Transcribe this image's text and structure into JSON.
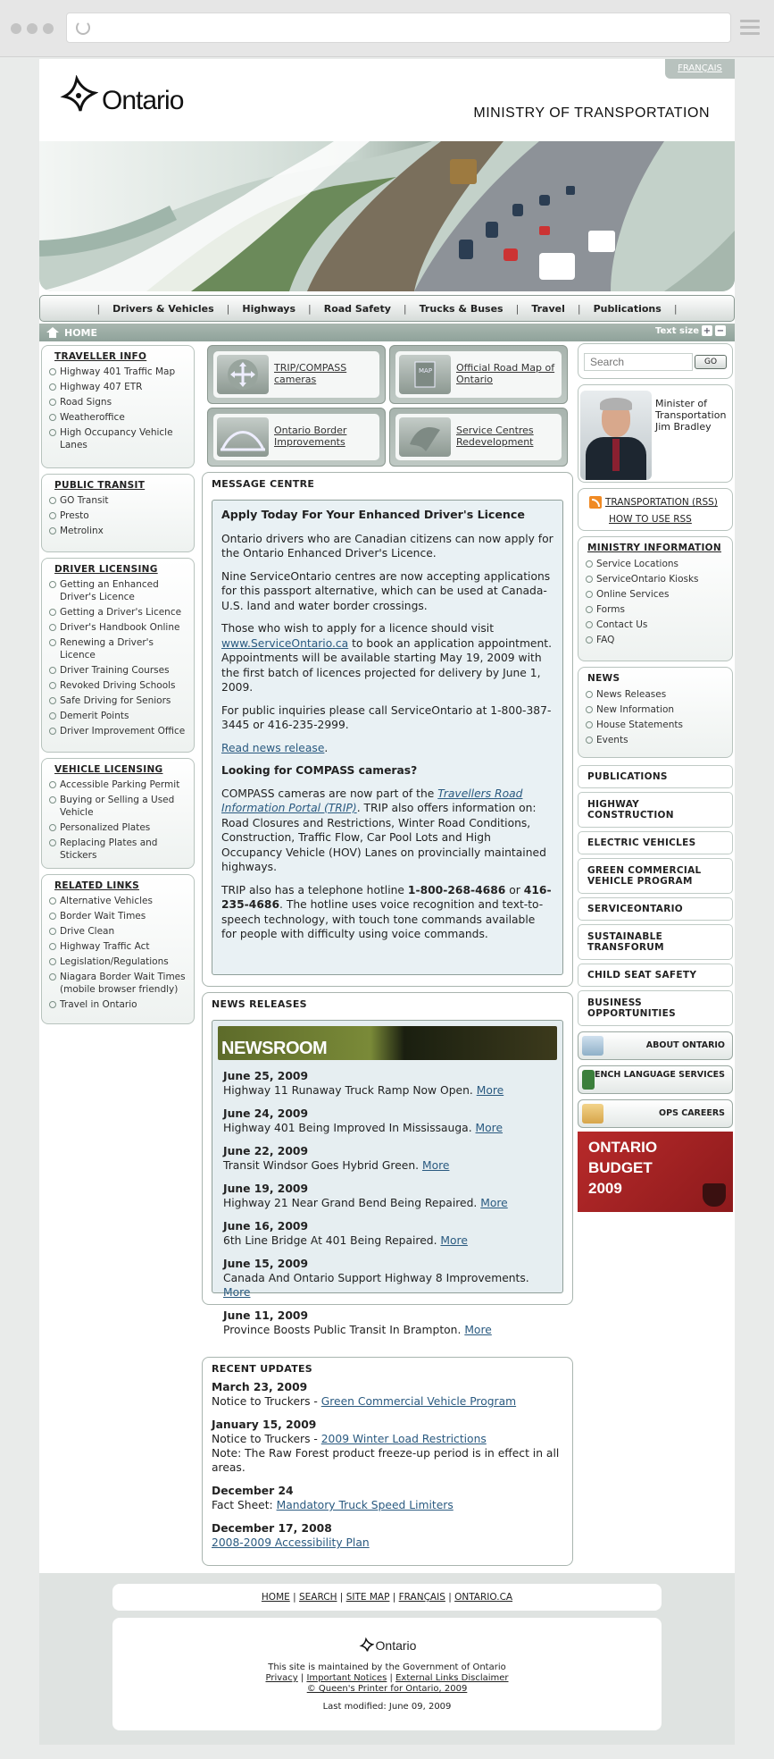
{
  "header": {
    "francais": "FRANÇAIS",
    "logo_text": "Ontario",
    "ministry": "MINISTRY OF TRANSPORTATION"
  },
  "nav": {
    "items": [
      "Drivers & Vehicles",
      "Highways",
      "Road Safety",
      "Trucks & Buses",
      "Travel",
      "Publications"
    ]
  },
  "homebar": {
    "home": "HOME",
    "text_size": "Text size",
    "plus": "+",
    "minus": "−"
  },
  "left": {
    "traveller": {
      "title": "TRAVELLER INFO",
      "items": [
        "Highway 401 Traffic Map",
        "Highway 407 ETR",
        "Road Signs",
        "Weatheroffice",
        "High Occupancy Vehicle Lanes"
      ]
    },
    "transit": {
      "title": "PUBLIC TRANSIT",
      "items": [
        "GO Transit",
        "Presto",
        "Metrolinx"
      ]
    },
    "driver": {
      "title": "DRIVER LICENSING",
      "items": [
        "Getting an Enhanced Driver's Licence",
        "Getting a Driver's Licence",
        "Driver's Handbook Online",
        "Renewing a Driver's Licence",
        "Driver Training Courses",
        "Revoked Driving Schools",
        "Safe Driving for Seniors",
        "Demerit Points",
        "Driver Improvement Office"
      ]
    },
    "vehicle": {
      "title": "VEHICLE LICENSING",
      "items": [
        "Accessible Parking Permit",
        "Buying or Selling a Used Vehicle",
        "Personalized Plates",
        "Replacing Plates and Stickers"
      ]
    },
    "related": {
      "title": "RELATED LINKS",
      "items": [
        "Alternative Vehicles",
        "Border Wait Times",
        "Drive Clean",
        "Highway Traffic Act",
        "Legislation/Regulations",
        "Niagara Border Wait Times (mobile browser friendly)",
        "Travel in Ontario"
      ]
    }
  },
  "tiles": [
    {
      "label": "TRIP/COMPASS cameras"
    },
    {
      "label": "Official Road Map of Ontario",
      "icon_text": "MAP"
    },
    {
      "label": "Ontario Border Improvements"
    },
    {
      "label": "Service Centres Redevelopment"
    }
  ],
  "message": {
    "title": "MESSAGE CENTRE",
    "heading": "Apply Today For Your Enhanced Driver's Licence",
    "p1": "Ontario drivers who are Canadian citizens can now apply for the Ontario Enhanced Driver's Licence.",
    "p2": "Nine ServiceOntario centres are now accepting applications for this passport alternative, which can be used at Canada-U.S. land and water border crossings.",
    "p3a": "Those who wish to apply for a licence should visit",
    "p3link": "www.ServiceOntario.ca",
    "p3b": "to book an application appointment. Appointments will be available starting May 19, 2009 with the first batch of licences projected for delivery by June 1, 2009.",
    "p4": "For public inquiries please call ServiceOntario at 1-800-387-3445 or 416-235-2999.",
    "readnews": "Read news release",
    "heading2": "Looking for COMPASS cameras?",
    "p5a": "COMPASS cameras are now part of the",
    "p5link": "Travellers Road Information Portal (TRIP)",
    "p5b": ". TRIP also offers information on: Road Closures and Restrictions, Winter Road Conditions, Construction, Traffic Flow, Car Pool Lots and High Occupancy Vehicle (HOV) Lanes on provincially maintained highways.",
    "p6a": "TRIP also has a telephone hotline",
    "p6phone1": "1-800-268-4686",
    "p6or": "or",
    "p6phone2": "416-235-4686",
    "p6b": ". The hotline uses voice recognition and text-to-speech technology, with touch tone commands available for people with difficulty using voice commands."
  },
  "news": {
    "title": "NEWS RELEASES",
    "banner": "NEWSROOM",
    "items": [
      {
        "date": "June 25, 2009",
        "text": "Highway 11 Runaway Truck Ramp Now Open.",
        "more": "More"
      },
      {
        "date": "June 24, 2009",
        "text": "Highway 401 Being Improved In Mississauga.",
        "more": "More"
      },
      {
        "date": "June 22, 2009",
        "text": "Transit Windsor Goes Hybrid Green.",
        "more": "More"
      },
      {
        "date": "June 19, 2009",
        "text": "Highway 21 Near Grand Bend Being Repaired.",
        "more": "More"
      },
      {
        "date": "June 16, 2009",
        "text": "6th Line Bridge At 401 Being Repaired.",
        "more": "More"
      },
      {
        "date": "June 15, 2009",
        "text": "Canada And Ontario Support Highway 8 Improvements.",
        "more": "More"
      },
      {
        "date": "June 11, 2009",
        "text": "Province Boosts Public Transit In Brampton.",
        "more": "More"
      }
    ]
  },
  "updates": {
    "title": "RECENT UPDATES",
    "items": [
      {
        "date": "March 23, 2009",
        "pre": "Notice to Truckers - ",
        "link": "Green Commercial Vehicle Program",
        "note": ""
      },
      {
        "date": "January 15, 2009",
        "pre": "Notice to Truckers - ",
        "link": "2009 Winter Load Restrictions",
        "note": "Note: The Raw Forest product freeze-up period is in effect in all areas."
      },
      {
        "date": "December 24",
        "pre": "Fact Sheet: ",
        "link": "Mandatory Truck Speed Limiters",
        "note": ""
      },
      {
        "date": "December 17, 2008",
        "pre": "",
        "link": "2008-2009 Accessibility Plan",
        "note": ""
      }
    ]
  },
  "right": {
    "search_placeholder": "Search",
    "go": "GO",
    "minister": {
      "l1": "Minister of",
      "l2": "Transportation",
      "l3": "Jim Bradley"
    },
    "rss": "TRANSPORTATION (RSS)",
    "howto": "HOW TO USE RSS",
    "mininfo": {
      "title": "MINISTRY INFORMATION",
      "items": [
        "Service Locations",
        "ServiceOntario Kiosks",
        "Online Services",
        "Forms",
        "Contact Us",
        "FAQ"
      ]
    },
    "news": {
      "title": "NEWS",
      "items": [
        "News Releases",
        "New Information",
        "House Statements",
        "Events"
      ]
    },
    "plain": [
      "PUBLICATIONS",
      "HIGHWAY CONSTRUCTION",
      "ELECTRIC VEHICLES",
      "GREEN COMMERCIAL VEHICLE PROGRAM",
      "SERVICEONTARIO",
      "SUSTAINABLE TRANSFORUM",
      "CHILD SEAT SAFETY",
      "BUSINESS OPPORTUNITIES"
    ],
    "promos": [
      "ABOUT ONTARIO",
      "FRENCH LANGUAGE SERVICES",
      "OPS CAREERS"
    ],
    "budget": {
      "l1": "ONTARIO",
      "l2": "BUDGET",
      "l3": "2009"
    }
  },
  "footer": {
    "links": [
      "HOME",
      "SEARCH",
      "SITE MAP",
      "FRANÇAIS",
      "ONTARIO.CA"
    ],
    "logo": "Ontario",
    "maintained": "This site is maintained by the Government of Ontario",
    "privacy": "Privacy",
    "notices": "Important Notices",
    "disclaimer": "External Links Disclaimer",
    "copyright": "© Queen's Printer for Ontario, 2009",
    "modified": "Last modified: June 09, 2009"
  }
}
